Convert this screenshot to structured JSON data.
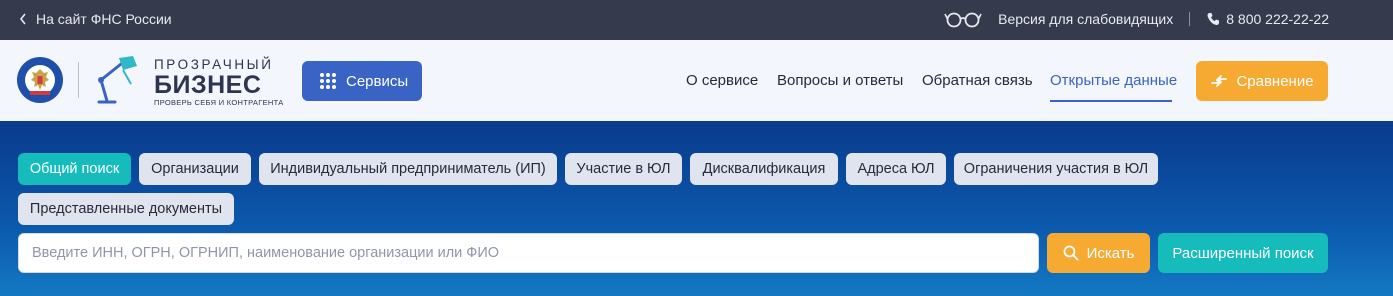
{
  "topbar": {
    "back_link": "На сайт ФНС России",
    "back_icon": "chevron-left-icon",
    "accessibility_icon": "glasses-icon",
    "accessibility_link": "Версия для слабовидящих",
    "phone_icon": "phone-icon",
    "phone": "8 800 222-22-22"
  },
  "header": {
    "emblem_icon": "fns-emblem-icon",
    "emblem_ring_text": "ФЕДЕРАЛЬНАЯ НАЛОГОВАЯ СЛУЖБА",
    "lamp_icon": "lamp-logo-icon",
    "brand_line1": "ПРОЗРАЧНЫЙ",
    "brand_line2": "БИЗНЕС",
    "brand_tagline": "ПРОВЕРЬ СЕБЯ И КОНТРАГЕНТА",
    "services_label": "Сервисы",
    "services_icon": "grid-dots-icon",
    "nav": [
      {
        "label": "О сервисе",
        "active": false
      },
      {
        "label": "Вопросы и ответы",
        "active": false
      },
      {
        "label": "Обратная связь",
        "active": false
      },
      {
        "label": "Открытые данные",
        "active": true
      }
    ],
    "compare_label": "Сравнение",
    "compare_icon": "compare-arrows-icon"
  },
  "search": {
    "tabs": [
      {
        "label": "Общий поиск",
        "active": true
      },
      {
        "label": "Организации",
        "active": false
      },
      {
        "label": "Индивидуальный предприниматель (ИП)",
        "active": false
      },
      {
        "label": "Участие в ЮЛ",
        "active": false
      },
      {
        "label": "Дисквалификация",
        "active": false
      },
      {
        "label": "Адреса ЮЛ",
        "active": false
      },
      {
        "label": "Ограничения участия в ЮЛ",
        "active": false
      },
      {
        "label": "Представленные документы",
        "active": false
      }
    ],
    "input_value": "",
    "input_placeholder": "Введите ИНН, ОГРН, ОГРНИП, наименование организации или ФИО",
    "search_button": "Искать",
    "search_icon": "search-icon",
    "advanced_button": "Расширенный поиск"
  },
  "colors": {
    "topbar_bg": "#353a4c",
    "header_bg": "#f3f6fc",
    "brand_blue": "#3a63c6",
    "accent_orange": "#f7aa32",
    "accent_teal": "#16bcbc",
    "hero_top": "#0a3a8c",
    "hero_bottom": "#1478c3"
  }
}
